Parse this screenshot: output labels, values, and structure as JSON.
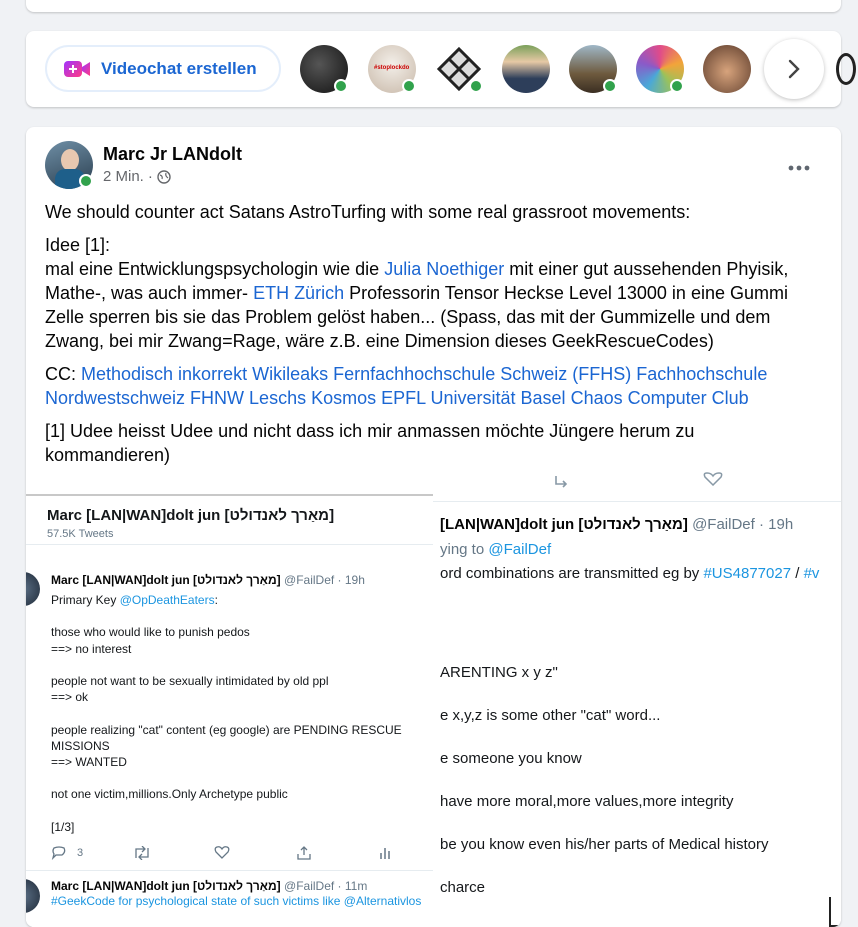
{
  "stories": {
    "videochat_label": "Videochat erstellen",
    "avatars": [
      {
        "name": "avatar-1",
        "online": true,
        "color": "#2a2a2a"
      },
      {
        "name": "avatar-2",
        "online": true,
        "color": "#d9d4cf"
      },
      {
        "name": "avatar-3",
        "online": true,
        "color": "#cfcfcf"
      },
      {
        "name": "avatar-4",
        "online": false,
        "color": "#3f5b7a"
      },
      {
        "name": "avatar-5",
        "online": true,
        "color": "#7d6a4c"
      },
      {
        "name": "avatar-6",
        "online": true,
        "color": "#b84a7c"
      },
      {
        "name": "avatar-7",
        "online": false,
        "color": "#6b4a3a"
      }
    ]
  },
  "post": {
    "author": "Marc Jr LANdolt",
    "time": "2 Min.",
    "separator": "·",
    "line1": "We should counter act Satans AstroTurfing with some real grassroot movements:",
    "idea_label": "Idee [1]:",
    "idea_text_1": "mal eine Entwicklungspsychologin wie die ",
    "idea_link_1": "Julia Noethiger",
    "idea_text_2": " mit einer gut aussehenden Phyisik, Mathe-, was auch immer- ",
    "idea_link_2": "ETH Zürich",
    "idea_text_3": " Professorin Tensor Heckse Level 13000 in eine Gummi Zelle sperren bis sie das Problem gelöst haben... (Spass, das mit der Gummizelle und dem Zwang, bei mir Zwang=Rage, wäre z.B. eine Dimension dieses GeekRescueCodes)",
    "cc_label": "CC: ",
    "cc_links": [
      "Methodisch inkorrekt",
      "Wikileaks",
      "Fernfachhochschule Schweiz (FFHS)",
      "Fachhochschule Nordwestschweiz FHNW",
      "Leschs Kosmos",
      "EPFL",
      "Universität Basel",
      "Chaos Computer Club"
    ],
    "footnote": "[1] Udee heisst Udee und nicht dass ich mir anmassen möchte Jüngere herum zu kommandieren)"
  },
  "screenshot": {
    "left": {
      "header_name": "Marc [LAN|WAN]dolt jun [מאַרך לאנדולט]",
      "header_tweets": "57.5K Tweets",
      "tweet1_name": "Marc [LAN|WAN]dolt jun [מאַרך לאנדולט]",
      "tweet1_handle": "@FailDef · 19h",
      "tweet1_lines": [
        "Primary Key @OpDeathEaters:",
        "",
        "those who would like to punish pedos",
        "==> no interest",
        "",
        "people not want to be sexually intimidated by old ppl",
        "==> ok",
        "",
        "people realizing \"cat\" content (eg google) are PENDING RESCUE",
        "MISSIONS",
        "==> WANTED",
        "",
        "not one victim,millions.Only Archetype public",
        "",
        "[1/3]"
      ],
      "tweet1_replies": "3",
      "tweet2_name": "Marc [LAN|WAN]dolt jun [מאַרך לאנדולט]",
      "tweet2_handle": "@FailDef · 11m",
      "tweet2_preview": "#GeekCode for psychological state of such victims like @Alternativlos"
    },
    "right": {
      "name": "[LAN|WAN]dolt jun [מאַרך לאנדולט]",
      "handle": "@FailDef · 19h",
      "replying": "ying to ",
      "replying_link": "@FailDef",
      "line1_text": "ord combinations are transmitted eg by ",
      "line1_link": "#US4877027",
      "line1_sep": " / ",
      "line1_link2": "#v",
      "lines": [
        "ARENTING x y z\"",
        "e x,y,z is some other \"cat\" word...",
        "e someone you know",
        "have more moral,more values,more integrity",
        "be you know even his/her parts of Medical history",
        "charce"
      ]
    }
  }
}
